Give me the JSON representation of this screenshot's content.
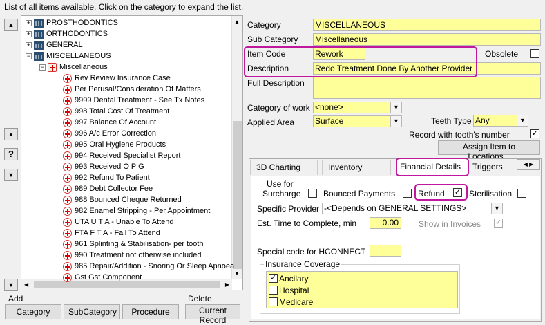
{
  "header_hint": "List of all items available. Click on the category to expand the list.",
  "tree": {
    "categories": [
      {
        "label": "PROSTHODONTICS",
        "expanded": false
      },
      {
        "label": "ORTHODONTICS",
        "expanded": false
      },
      {
        "label": "GENERAL",
        "expanded": false
      },
      {
        "label": "MISCELLANEOUS",
        "expanded": true
      }
    ],
    "subcategory": "Miscellaneous",
    "items": [
      "Rev Review Insurance Case",
      "Per Perusal/Consideration Of Matters",
      "9999 Dental Treatment - See Tx Notes",
      "998 Total Cost Of Treatment",
      "997 Balance Of Account",
      "996 A/c Error Correction",
      "995 Oral Hygiene Products",
      "994 Received Specialist Report",
      "993 Received O P G",
      "992 Refund To Patient",
      "989 Debt Collector Fee",
      "988 Bounced Cheque Returned",
      "982 Enamel Stripping - Per Appointment",
      "UTA U T A - Unable To Attend",
      "FTA F T A - Fail To Attend",
      "961 Splinting & Stabilisation- per tooth",
      "990 Treatment not otherwise included",
      "985 Repair/Addition - Snoring Or Sleep Apnoea",
      "Gst Gst Component"
    ]
  },
  "bottom": {
    "add_label": "Add",
    "delete_label": "Delete",
    "category_btn": "Category",
    "subcategory_btn": "SubCategory",
    "procedure_btn": "Procedure",
    "current_record_btn": "Current Record"
  },
  "form": {
    "category_label": "Category",
    "category_value": "MISCELLANEOUS",
    "subcategory_label": "Sub Category",
    "subcategory_value": "Miscellaneous",
    "item_code_label": "Item Code",
    "item_code_value": "Rework",
    "obsolete_label": "Obsolete",
    "description_label": "Description",
    "description_value": "Redo Treatment Done By Another Provider",
    "full_description_label": "Full Description",
    "category_of_work_label": "Category of work",
    "category_of_work_value": "<none>",
    "applied_area_label": "Applied Area",
    "applied_area_value": "Surface",
    "teeth_type_label": "Teeth Type",
    "teeth_type_value": "Any",
    "record_with_tooth_label": "Record with tooth's number",
    "assign_btn": "Assign Item to Locations..."
  },
  "tabs": [
    "3D Charting",
    "Inventory",
    "Financial Details",
    "Triggers"
  ],
  "financial": {
    "use_for_label": "Use for",
    "surcharge_label": "Surcharge",
    "bounced_label": "Bounced Payments",
    "refund_label": "Refund",
    "sterilisation_label": "Sterilisation",
    "specific_provider_label": "Specific Provider",
    "specific_provider_value": "-<Depends on GENERAL SETTINGS>",
    "est_time_label": "Est. Time to Complete, min",
    "est_time_value": "0.00",
    "show_invoices_label": "Show in Invoices",
    "hconnect_label": "Special code for HCONNECT",
    "insurance_label": "Insurance Coverage",
    "insurance_items": [
      {
        "label": "Ancilary",
        "checked": true
      },
      {
        "label": "Hospital",
        "checked": false
      },
      {
        "label": "Medicare",
        "checked": false
      }
    ]
  },
  "check_glyph": "✓"
}
